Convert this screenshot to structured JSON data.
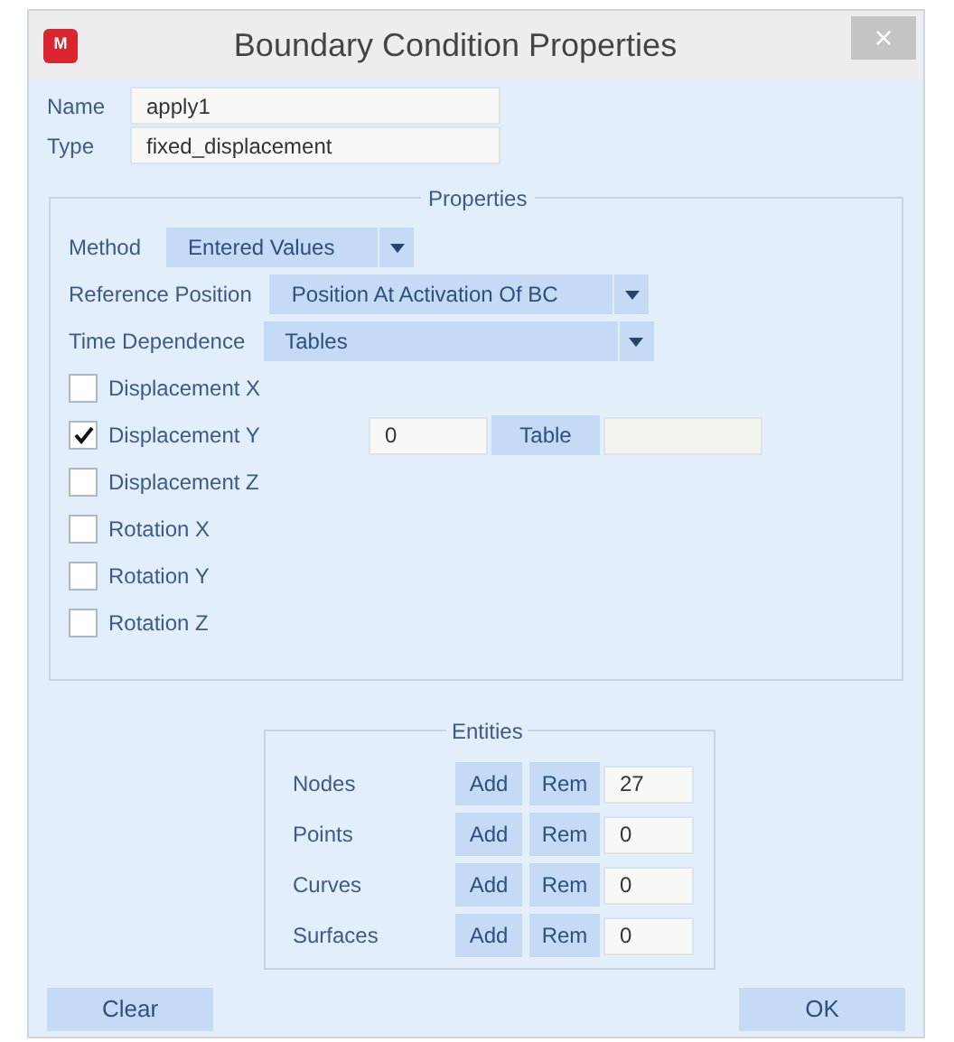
{
  "window": {
    "title": "Boundary Condition Properties",
    "close": "×",
    "app_icon": "M"
  },
  "fields": [
    {
      "label": "Name",
      "value": "apply1"
    },
    {
      "label": "Type",
      "value": "fixed_displacement"
    }
  ],
  "properties": {
    "title": "Properties",
    "dropdowns": [
      {
        "label": "Method",
        "value": "Entered Values"
      },
      {
        "label": "Reference Position",
        "value": "Position At Activation Of BC"
      },
      {
        "label": "Time Dependence",
        "value": "Tables"
      }
    ],
    "checkboxes": [
      {
        "label": "Displacement X",
        "checked": false
      },
      {
        "label": "Displacement Y",
        "checked": true,
        "value": "0",
        "button": "Table"
      },
      {
        "label": "Displacement Z",
        "checked": false
      },
      {
        "label": "Rotation X",
        "checked": false
      },
      {
        "label": "Rotation Y",
        "checked": false
      },
      {
        "label": "Rotation Z",
        "checked": false
      }
    ]
  },
  "entities": {
    "title": "Entities",
    "rows": [
      {
        "label": "Nodes",
        "add": "Add",
        "rem": "Rem",
        "value": "27"
      },
      {
        "label": "Points",
        "add": "Add",
        "rem": "Rem",
        "value": "0"
      },
      {
        "label": "Curves",
        "add": "Add",
        "rem": "Rem",
        "value": "0"
      },
      {
        "label": "Surfaces",
        "add": "Add",
        "rem": "Rem",
        "value": "0"
      }
    ]
  },
  "buttons": [
    "Clear",
    "OK"
  ]
}
